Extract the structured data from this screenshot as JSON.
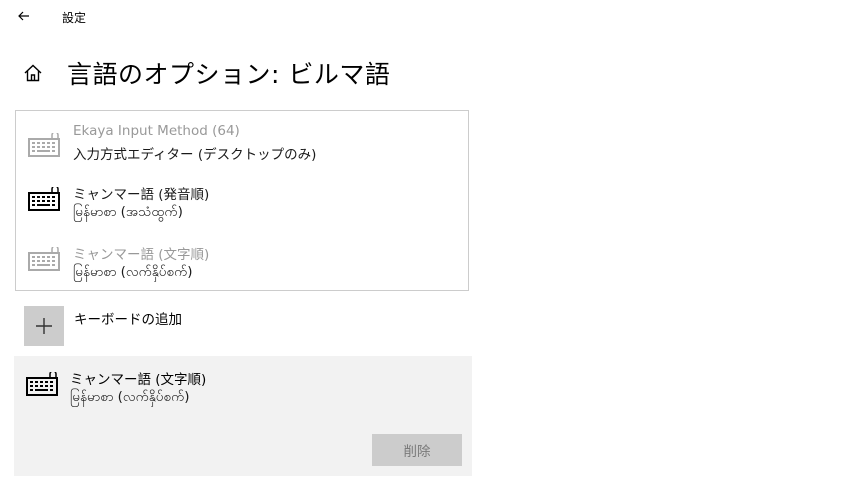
{
  "window": {
    "title": "設定"
  },
  "page": {
    "title": "言語のオプション: ビルマ語"
  },
  "keyboards": [
    {
      "name": "Ekaya Input Method (64)",
      "subtitle": "入力方式エディター (デスクトップのみ)",
      "state": "disabled"
    },
    {
      "name": "ミャンマー語 (発音順)",
      "subtitle": "မြန်မာစာ (အသံထွက်)",
      "state": "normal"
    },
    {
      "name": "ミャンマー語 (文字順)",
      "subtitle": "မြန်မာစာ (လက်နှိပ်စက်)",
      "state": "disabled"
    }
  ],
  "add_keyboard": {
    "label": "キーボードの追加"
  },
  "selected_keyboard": {
    "name": "ミャンマー語 (文字順)",
    "subtitle": "မြန်မာစာ (လက်နှိပ်စက်)",
    "remove_label": "削除"
  },
  "icons": {
    "back": "arrow-left-icon",
    "home": "home-icon",
    "keyboard": "keyboard-icon",
    "add": "plus-icon"
  },
  "colors": {
    "disabled_text": "#999999",
    "selected_bg": "#f2f2f2",
    "button_bg": "#cccccc"
  }
}
